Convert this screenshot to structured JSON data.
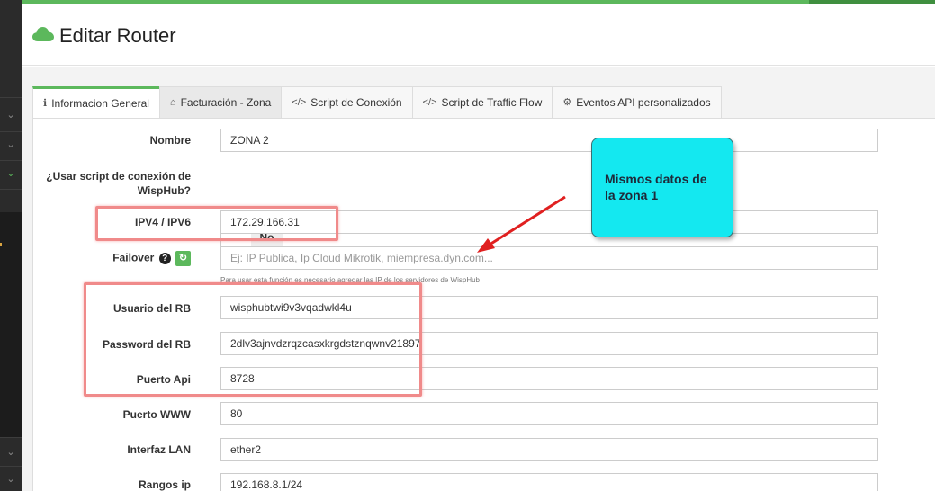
{
  "header": {
    "title": "Editar Router",
    "icon": "cloud-icon"
  },
  "tabs": [
    {
      "label": "Informacion General",
      "icon": "info-icon",
      "glyph": "ℹ"
    },
    {
      "label": "Facturación - Zona",
      "icon": "home-icon",
      "glyph": "⌂"
    },
    {
      "label": "Script de Conexión",
      "icon": "code-icon",
      "glyph": "</>"
    },
    {
      "label": "Script de Traffic Flow",
      "icon": "code-icon",
      "glyph": "</>"
    },
    {
      "label": "Eventos API personalizados",
      "icon": "gear-icon",
      "glyph": "⚙"
    }
  ],
  "form": {
    "nombre": {
      "label": "Nombre",
      "value": "ZONA 2"
    },
    "script": {
      "label_line1": "¿Usar script de conexión de",
      "label_line2": "WispHub?",
      "toggle": "No"
    },
    "ip": {
      "label": "IPV4 / IPV6",
      "value": "172.29.166.31"
    },
    "failover": {
      "label": "Failover",
      "placeholder": "Ej: IP Publica, Ip Cloud Mikrotik, miempresa.dyn.com...",
      "help": "Para usar esta función es necesario agregar las IP de los servidores de WispHub",
      "q": "?",
      "refresh": "↻"
    },
    "usuario": {
      "label": "Usuario del RB",
      "value": "wisphubtwi9v3vqadwkl4u"
    },
    "password": {
      "label": "Password del RB",
      "value": "2dlv3ajnvdzrqzcasxkrgdstznqwnv21897"
    },
    "puerto_api": {
      "label": "Puerto Api",
      "value": "8728"
    },
    "puerto_www": {
      "label": "Puerto WWW",
      "value": "80"
    },
    "interfaz": {
      "label": "Interfaz LAN",
      "value": "ether2"
    },
    "rangos": {
      "label": "Rangos ip",
      "value": "192.168.8.1/24"
    }
  },
  "annotation": {
    "line1": "Mismos datos de",
    "line2": "la zona 1"
  },
  "colors": {
    "accent": "#5cb85c",
    "callout": "#14e8f0",
    "highlight": "#f08a8a",
    "arrow": "#e02020"
  }
}
